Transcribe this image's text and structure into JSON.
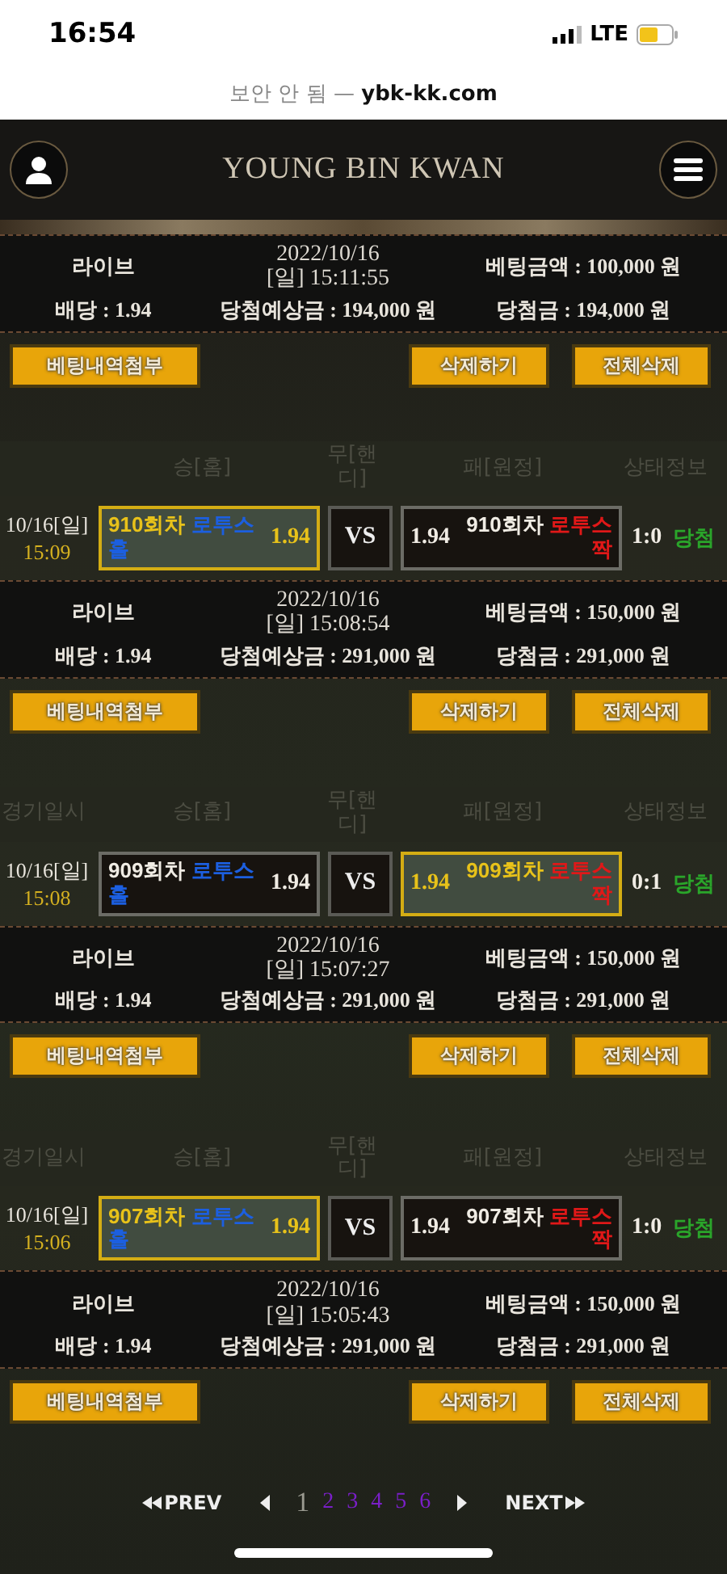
{
  "status_bar": {
    "time": "16:54",
    "network": "LTE"
  },
  "address_bar": {
    "text": "보안 안 됨 — **ybk-kk.com**"
  },
  "header": {
    "logo": "YOUNG BIN KWAN"
  },
  "sections": [
    {
      "info": {
        "type": "라이브",
        "date": "2022/10/16",
        "time": "[일] 15:11:55",
        "stake": "베팅금액 : 100,000 원",
        "odds": "배당 : 1.94",
        "expected": "당첨예상금 : 194,000 원",
        "payout": "당첨금 : 194,000 원"
      },
      "buttons": [
        "베팅내역첨부",
        "삭제하기",
        "전체삭제"
      ]
    },
    {
      "columns": [
        "승[홈]",
        "무[핸디]",
        "패[원정]",
        "상태정보"
      ],
      "game": {
        "date": "10/16[일]",
        "time": "15:09",
        "home": {
          "round": "910회차",
          "name": "로투스 홀",
          "odds": "1.94",
          "selected": true
        },
        "vs": "VS",
        "away": {
          "round": "910회차",
          "name": "로투스 짝",
          "odds": "1.94",
          "selected": false
        },
        "score": "1:0",
        "result": "당첨"
      },
      "info": {
        "type": "라이브",
        "date": "2022/10/16",
        "time": "[일] 15:08:54",
        "stake": "베팅금액 : 150,000 원",
        "odds": "배당 : 1.94",
        "expected": "당첨예상금 : 291,000 원",
        "payout": "당첨금 : 291,000 원"
      },
      "buttons": [
        "베팅내역첨부",
        "삭제하기",
        "전체삭제"
      ]
    },
    {
      "columns": [
        "경기일시",
        "승[홈]",
        "무[핸디]",
        "패[원정]",
        "상태정보"
      ],
      "game": {
        "date": "10/16[일]",
        "time": "15:08",
        "home": {
          "round": "909회차",
          "name": "로투스 홀",
          "odds": "1.94",
          "selected": false
        },
        "vs": "VS",
        "away": {
          "round": "909회차",
          "name": "로투스 짝",
          "odds": "1.94",
          "selected": true
        },
        "score": "0:1",
        "result": "당첨"
      },
      "info": {
        "type": "라이브",
        "date": "2022/10/16",
        "time": "[일] 15:07:27",
        "stake": "베팅금액 : 150,000 원",
        "odds": "배당 : 1.94",
        "expected": "당첨예상금 : 291,000 원",
        "payout": "당첨금 : 291,000 원"
      },
      "buttons": [
        "베팅내역첨부",
        "삭제하기",
        "전체삭제"
      ]
    },
    {
      "columns": [
        "경기일시",
        "승[홈]",
        "무[핸디]",
        "패[원정]",
        "상태정보"
      ],
      "game": {
        "date": "10/16[일]",
        "time": "15:06",
        "home": {
          "round": "907회차",
          "name": "로투스 홀",
          "odds": "1.94",
          "selected": true
        },
        "vs": "VS",
        "away": {
          "round": "907회차",
          "name": "로투스 짝",
          "odds": "1.94",
          "selected": false
        },
        "score": "1:0",
        "result": "당첨"
      },
      "info": {
        "type": "라이브",
        "date": "2022/10/16",
        "time": "[일] 15:05:43",
        "stake": "베팅금액 : 150,000 원",
        "odds": "배당 : 1.94",
        "expected": "당첨예상금 : 291,000 원",
        "payout": "당첨금 : 291,000 원"
      },
      "buttons": [
        "베팅내역첨부",
        "삭제하기",
        "전체삭제"
      ]
    }
  ],
  "pagination": {
    "prev": "PREV",
    "next": "NEXT",
    "pages": [
      {
        "label": "1",
        "selected": true
      },
      {
        "label": "2",
        "selected": false
      },
      {
        "label": "3",
        "selected": false
      },
      {
        "label": "4",
        "selected": false
      },
      {
        "label": "5",
        "selected": false
      },
      {
        "label": "6",
        "selected": false
      }
    ]
  }
}
